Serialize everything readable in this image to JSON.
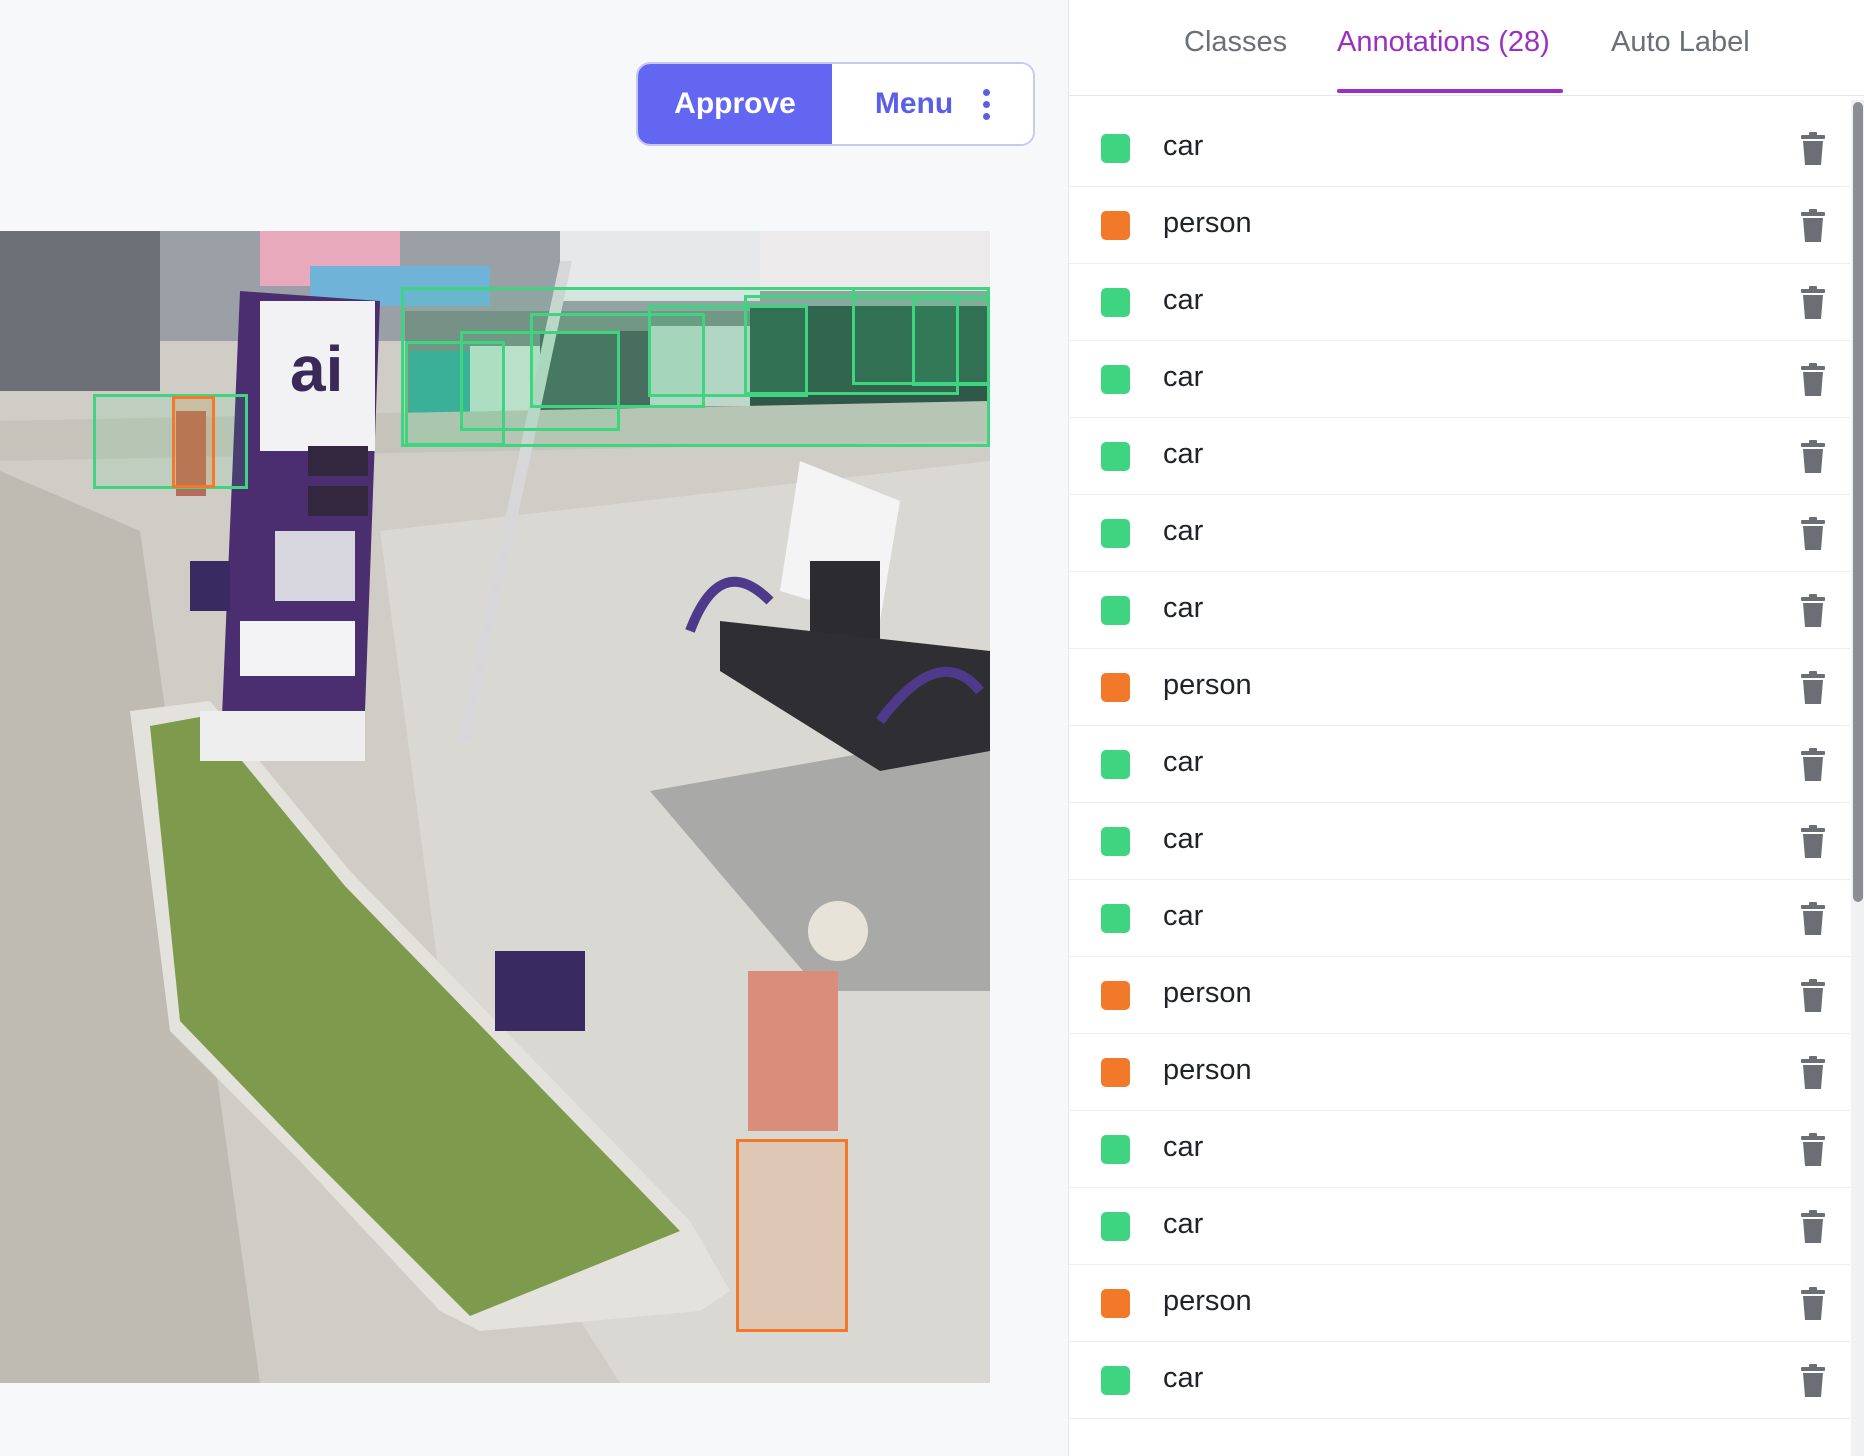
{
  "toolbar": {
    "approve_label": "Approve",
    "menu_label": "Menu"
  },
  "tabs": [
    {
      "label": "Classes",
      "active": false
    },
    {
      "label": "Annotations (28)",
      "active": true
    },
    {
      "label": "Auto Label",
      "active": false
    }
  ],
  "colors": {
    "accent": "#6366f1",
    "active_tab": "#9b2fc3",
    "car": "#3fd47f",
    "person": "#f2782a"
  },
  "annotations": [
    {
      "label": "car",
      "class": "car"
    },
    {
      "label": "person",
      "class": "person"
    },
    {
      "label": "car",
      "class": "car"
    },
    {
      "label": "car",
      "class": "car"
    },
    {
      "label": "car",
      "class": "car"
    },
    {
      "label": "car",
      "class": "car"
    },
    {
      "label": "car",
      "class": "car"
    },
    {
      "label": "person",
      "class": "person"
    },
    {
      "label": "car",
      "class": "car"
    },
    {
      "label": "car",
      "class": "car"
    },
    {
      "label": "car",
      "class": "car"
    },
    {
      "label": "person",
      "class": "person"
    },
    {
      "label": "person",
      "class": "person"
    },
    {
      "label": "car",
      "class": "car"
    },
    {
      "label": "car",
      "class": "car"
    },
    {
      "label": "person",
      "class": "person"
    },
    {
      "label": "car",
      "class": "car"
    }
  ],
  "icons": {
    "delete": "trash-icon",
    "menu": "kebab-icon"
  }
}
